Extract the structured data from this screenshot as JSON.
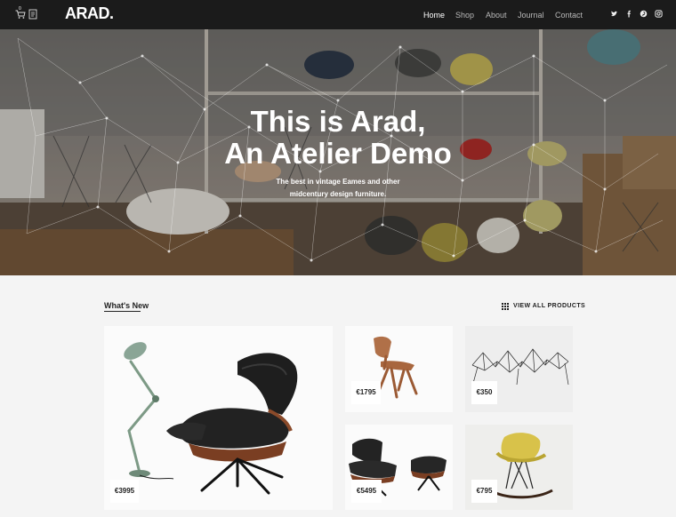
{
  "header": {
    "logo": "ARAD.",
    "nav": [
      "Home",
      "Shop",
      "About",
      "Journal",
      "Contact"
    ],
    "active_nav": "Home",
    "cart_count": "0",
    "icons": [
      "cart-icon",
      "document-icon"
    ],
    "social_icons": [
      "twitter-icon",
      "facebook-icon",
      "pinterest-icon",
      "instagram-icon"
    ]
  },
  "hero": {
    "title_line1": "This is Arad,",
    "title_line2": "An Atelier Demo",
    "subtitle_line1": "The best in vintage Eames and other",
    "subtitle_line2": "midcentury design furniture."
  },
  "section": {
    "title": "What's New",
    "view_all": "VIEW ALL PRODUCTS"
  },
  "products": [
    {
      "price": "€3995",
      "image": "lounge-chair-and-lamp"
    },
    {
      "price": "€1795",
      "image": "plywood-chair"
    },
    {
      "price": "€350",
      "image": "wire-sculpture"
    },
    {
      "price": "€5495",
      "image": "lounge-chair-with-ottoman"
    },
    {
      "price": "€795",
      "image": "yellow-rocker-chair"
    }
  ],
  "colors": {
    "header_bg": "#1b1b1b",
    "page_bg": "#f4f4f4",
    "text": "#222222"
  }
}
